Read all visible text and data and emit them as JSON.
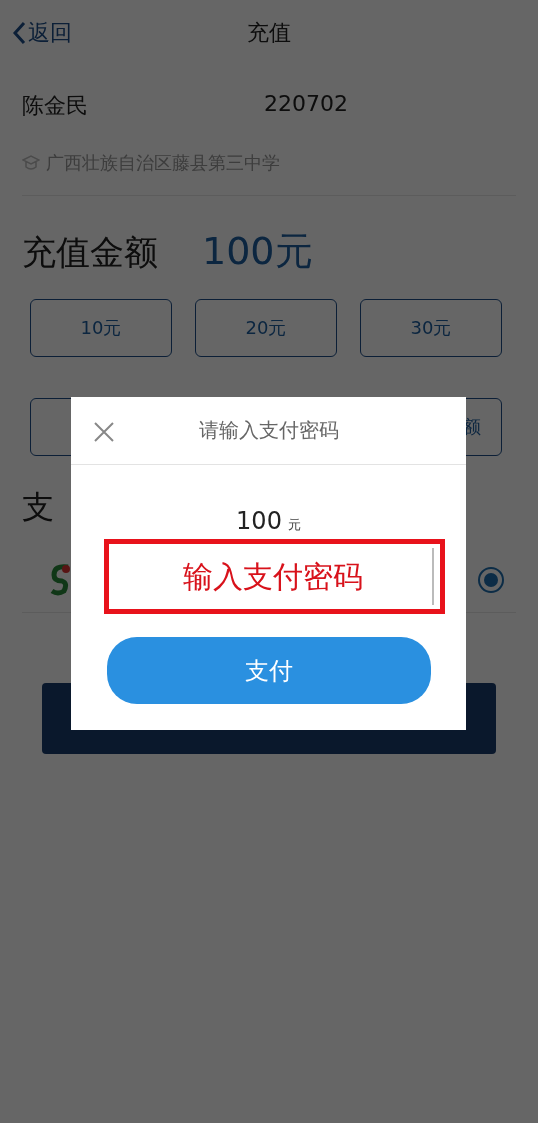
{
  "nav": {
    "back": "返回",
    "title": "充值"
  },
  "user": {
    "name": "陈金民",
    "id": "220702",
    "school": "广西壮族自治区藤县第三中学"
  },
  "amount": {
    "label": "充值金额",
    "value": "100元"
  },
  "options": [
    {
      "kind": "label",
      "label": "10元"
    },
    {
      "kind": "label",
      "label": "20元"
    },
    {
      "kind": "label",
      "label": "30元"
    },
    {
      "kind": "covered"
    },
    {
      "kind": "label",
      "label": "额"
    }
  ],
  "payment": {
    "heading": "支",
    "methods": [
      {
        "selected": true
      }
    ]
  },
  "dialog": {
    "title": "请输入支付密码",
    "amount": "100",
    "unit": "元",
    "password": {
      "placeholder": "输入支付密码"
    },
    "button": "支付"
  }
}
